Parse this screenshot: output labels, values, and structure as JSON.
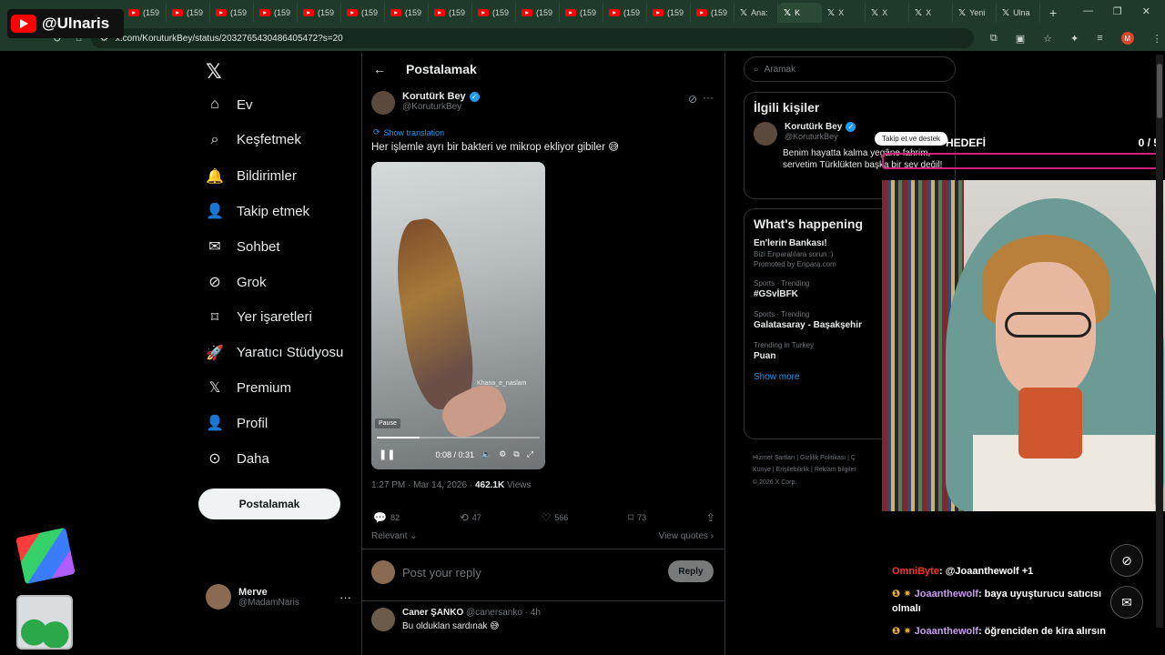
{
  "browser": {
    "tabs": [
      {
        "label": "(159",
        "kind": "yt"
      },
      {
        "label": "(159",
        "kind": "yt"
      },
      {
        "label": "(159",
        "kind": "yt"
      },
      {
        "label": "(159",
        "kind": "yt"
      },
      {
        "label": "(159",
        "kind": "yt"
      },
      {
        "label": "(159",
        "kind": "yt"
      },
      {
        "label": "(159",
        "kind": "yt"
      },
      {
        "label": "(159",
        "kind": "yt"
      },
      {
        "label": "(159",
        "kind": "yt"
      },
      {
        "label": "(159",
        "kind": "yt"
      },
      {
        "label": "(159",
        "kind": "yt"
      },
      {
        "label": "(159",
        "kind": "yt"
      },
      {
        "label": "(159",
        "kind": "yt"
      },
      {
        "label": "(159",
        "kind": "yt"
      },
      {
        "label": "Ana:",
        "kind": "x"
      },
      {
        "label": "K",
        "kind": "x",
        "active": true
      },
      {
        "label": "X",
        "kind": "x"
      },
      {
        "label": "X",
        "kind": "x"
      },
      {
        "label": "X",
        "kind": "x"
      },
      {
        "label": "Yeni",
        "kind": "x"
      },
      {
        "label": "Ulna",
        "kind": "x"
      }
    ],
    "url": "x.com/KoruturkBey/status/2032765430486405472?s=20",
    "profile_initial": "M"
  },
  "stream_logo": "@Ulnaris",
  "nav": {
    "items": [
      {
        "label": "Ev",
        "icon": "home-icon"
      },
      {
        "label": "Keşfetmek",
        "icon": "search-icon"
      },
      {
        "label": "Bildirimler",
        "icon": "bell-icon"
      },
      {
        "label": "Takip etmek",
        "icon": "follow-icon"
      },
      {
        "label": "Sohbet",
        "icon": "mail-icon"
      },
      {
        "label": "Grok",
        "icon": "grok-icon"
      },
      {
        "label": "Yer işaretleri",
        "icon": "bookmark-icon"
      },
      {
        "label": "Yaratıcı Stüdyosu",
        "icon": "rocket-icon"
      },
      {
        "label": "Premium",
        "icon": "x-icon"
      },
      {
        "label": "Profil",
        "icon": "profile-icon"
      },
      {
        "label": "Daha",
        "icon": "more-icon"
      }
    ],
    "post_label": "Postalamak",
    "me": {
      "name": "Merve",
      "handle": "@MadamNaris"
    }
  },
  "main": {
    "header": "Postalamak",
    "author": {
      "name": "Korutürk Bey",
      "handle": "@KoruturkBey"
    },
    "show_translation": "Show translation",
    "text": "Her işlemle ayrı bir bakteri ve mikrop ekliyor gibiler 😅",
    "video": {
      "watermark": "Khana_e_naslam",
      "pause_tip": "Pause",
      "time": "0:08 / 0:31",
      "progress": 0.26
    },
    "meta": {
      "time": "1:27 PM · Mar 14, 2026 · ",
      "views": "462.1K",
      "views_label": " Views"
    },
    "stats": {
      "replies": "82",
      "reposts": "47",
      "likes": "566",
      "bookmarks": "73"
    },
    "relevant": "Relevant",
    "view_quotes": "View quotes",
    "reply_placeholder": "Post your reply",
    "reply_button": "Reply",
    "next_reply": {
      "name": "Caner ŞANKO",
      "handle": "@canersanko · 4h",
      "text": "Bu olduklan sardınak 😅"
    }
  },
  "right": {
    "search_placeholder": "Aramak",
    "related_title": "İlgili kişiler",
    "related": {
      "name": "Korutürk Bey",
      "handle": "@KoruturkBey",
      "bio": "Benim hayatta kalma yegâne fahrim, servetim Türklükten başka bir şey değil!"
    },
    "happening_title": "What's happening",
    "trends": [
      {
        "sub": "",
        "title": "En'lerin Bankası!"
      },
      {
        "sub": "Bizi Enparalılara sorun :)",
        "title": ""
      },
      {
        "sub": "Promoted by Enpara.com",
        "title": ""
      },
      {
        "sub": "Sports · Trending",
        "title": "#GSvİBFK"
      },
      {
        "sub": "Sports · Trending",
        "title": "Galatasaray - Başakşehir"
      },
      {
        "sub": "Trending in Turkey",
        "title": "Puan"
      }
    ],
    "show_more": "Show more",
    "footer": [
      "Hizmet Şartları | Gizlilik Politikası | Ç",
      "Künye | Erişilebilirlik | Reklam bilgiler",
      "© 2026 X Corp."
    ]
  },
  "overlay": {
    "goal_label": "HEDEFİ",
    "goal_count": "0 / 5",
    "goal_tip": "Takip et ve destek",
    "chat": [
      {
        "user": "OmniByte",
        "text": ": @Joaanthewolf +1",
        "color": "u1"
      },
      {
        "user": "Joaanthewolf",
        "text": ": baya uyuşturucu satıcısı olmalı",
        "color": "u2"
      },
      {
        "user": "Joaanthewolf",
        "text": ": öğrenciden de kira alırsın",
        "color": "u2"
      }
    ]
  }
}
